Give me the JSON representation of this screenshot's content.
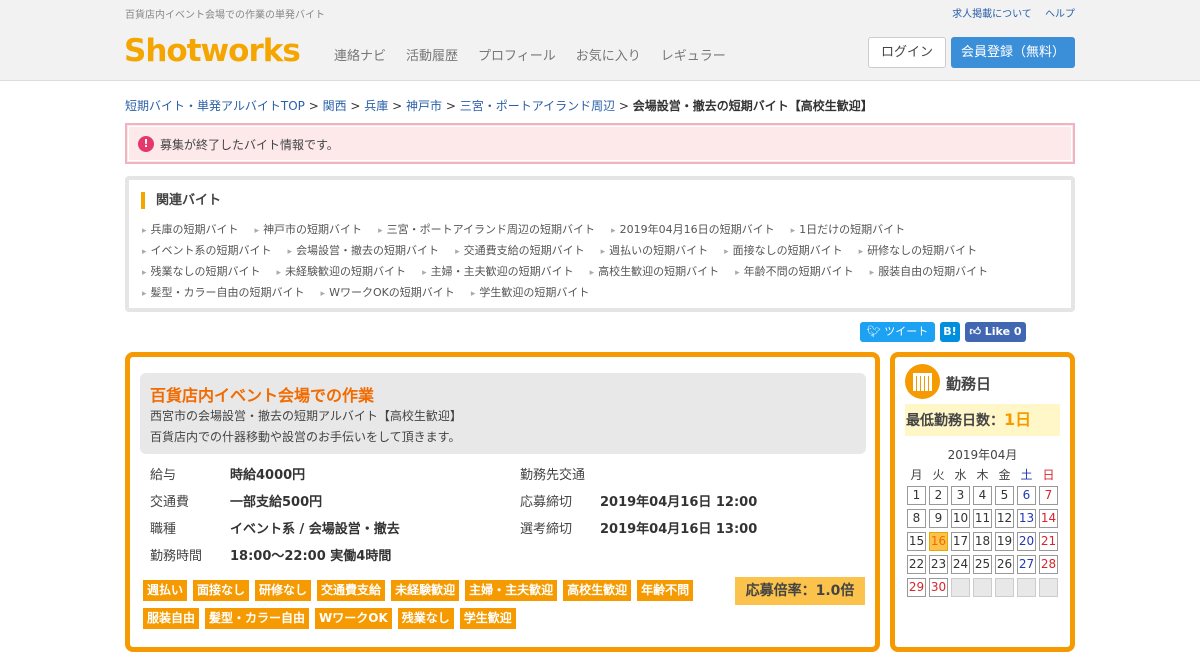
{
  "topbar": {
    "tagline": "百貨店内イベント会場での作業の単発バイト",
    "link1": "求人掲載について",
    "link2": "ヘルプ"
  },
  "header": {
    "logo": "Shotworks",
    "nav": [
      "連絡ナビ",
      "活動履歴",
      "プロフィール",
      "お気に入り",
      "レギュラー"
    ],
    "login": "ログイン",
    "register": "会員登録（無料）"
  },
  "breadcrumb": {
    "items": [
      "短期バイト・単発アルバイトTOP",
      "関西",
      "兵庫",
      "神戸市",
      "三宮・ポートアイランド周辺"
    ],
    "separator": " > ",
    "current": "会場設営・撤去の短期バイト【高校生歓迎】"
  },
  "alert": {
    "icon": "!",
    "text": "募集が終了したバイト情報です。"
  },
  "related": {
    "heading": "関連バイト",
    "rows": [
      [
        "兵庫の短期バイト",
        "神戸市の短期バイト",
        "三宮・ポートアイランド周辺の短期バイト",
        "2019年04月16日の短期バイト",
        "1日だけの短期バイト"
      ],
      [
        "イベント系の短期バイト",
        "会場設営・撤去の短期バイト",
        "交通費支給の短期バイト",
        "週払いの短期バイト",
        "面接なしの短期バイト",
        "研修なしの短期バイト"
      ],
      [
        "残業なしの短期バイト",
        "未経験歓迎の短期バイト",
        "主婦・主夫歓迎の短期バイト",
        "高校生歓迎の短期バイト",
        "年齢不問の短期バイト",
        "服装自由の短期バイト"
      ],
      [
        "髪型・カラー自由の短期バイト",
        "WワークOKの短期バイト",
        "学生歓迎の短期バイト"
      ]
    ]
  },
  "social": {
    "tweet": "ツイート",
    "hatena": "B!",
    "like": "Like 0"
  },
  "job": {
    "title": "百貨店内イベント会場での作業",
    "subtitle": "西宮市の会場設営・撤去の短期アルバイト【高校生歓迎】",
    "description": "百貨店内での什器移動や設営のお手伝いをして頂きます。",
    "left": [
      {
        "label": "給与",
        "value": "時給4000円"
      },
      {
        "label": "交通費",
        "value": "一部支給500円"
      },
      {
        "label": "職種",
        "value": "イベント系 / 会場設営・撤去"
      },
      {
        "label": "勤務時間",
        "value": "18:00～22:00 実働4時間"
      }
    ],
    "right": [
      {
        "label": "勤務先交通",
        "value": ""
      },
      {
        "label": "応募締切",
        "value": "2019年04月16日 12:00"
      },
      {
        "label": "選考締切",
        "value": "2019年04月16日 13:00"
      }
    ],
    "tags_row1": [
      "週払い",
      "面接なし",
      "研修なし",
      "交通費支給",
      "未経験歓迎",
      "主婦・主夫歓迎",
      "高校生歓迎",
      "年齢不問"
    ],
    "tags_row2": [
      "服装自由",
      "髪型・カラー自由",
      "WワークOK",
      "残業なし",
      "学生歓迎"
    ],
    "rate": "応募倍率：1.0倍"
  },
  "workdays": {
    "title": "勤務日",
    "min_label": "最低勤務日数：",
    "min_value": "1日",
    "month": "2019年04月",
    "weekdays": [
      "月",
      "火",
      "水",
      "木",
      "金",
      "土",
      "日"
    ],
    "days": [
      "1",
      "2",
      "3",
      "4",
      "5",
      "6",
      "7",
      "8",
      "9",
      "10",
      "11",
      "12",
      "13",
      "14",
      "15",
      "16",
      "17",
      "18",
      "19",
      "20",
      "21",
      "22",
      "23",
      "24",
      "25",
      "26",
      "27",
      "28",
      "29",
      "30"
    ],
    "highlight_day": "16",
    "accent_color": "#f59a00"
  }
}
